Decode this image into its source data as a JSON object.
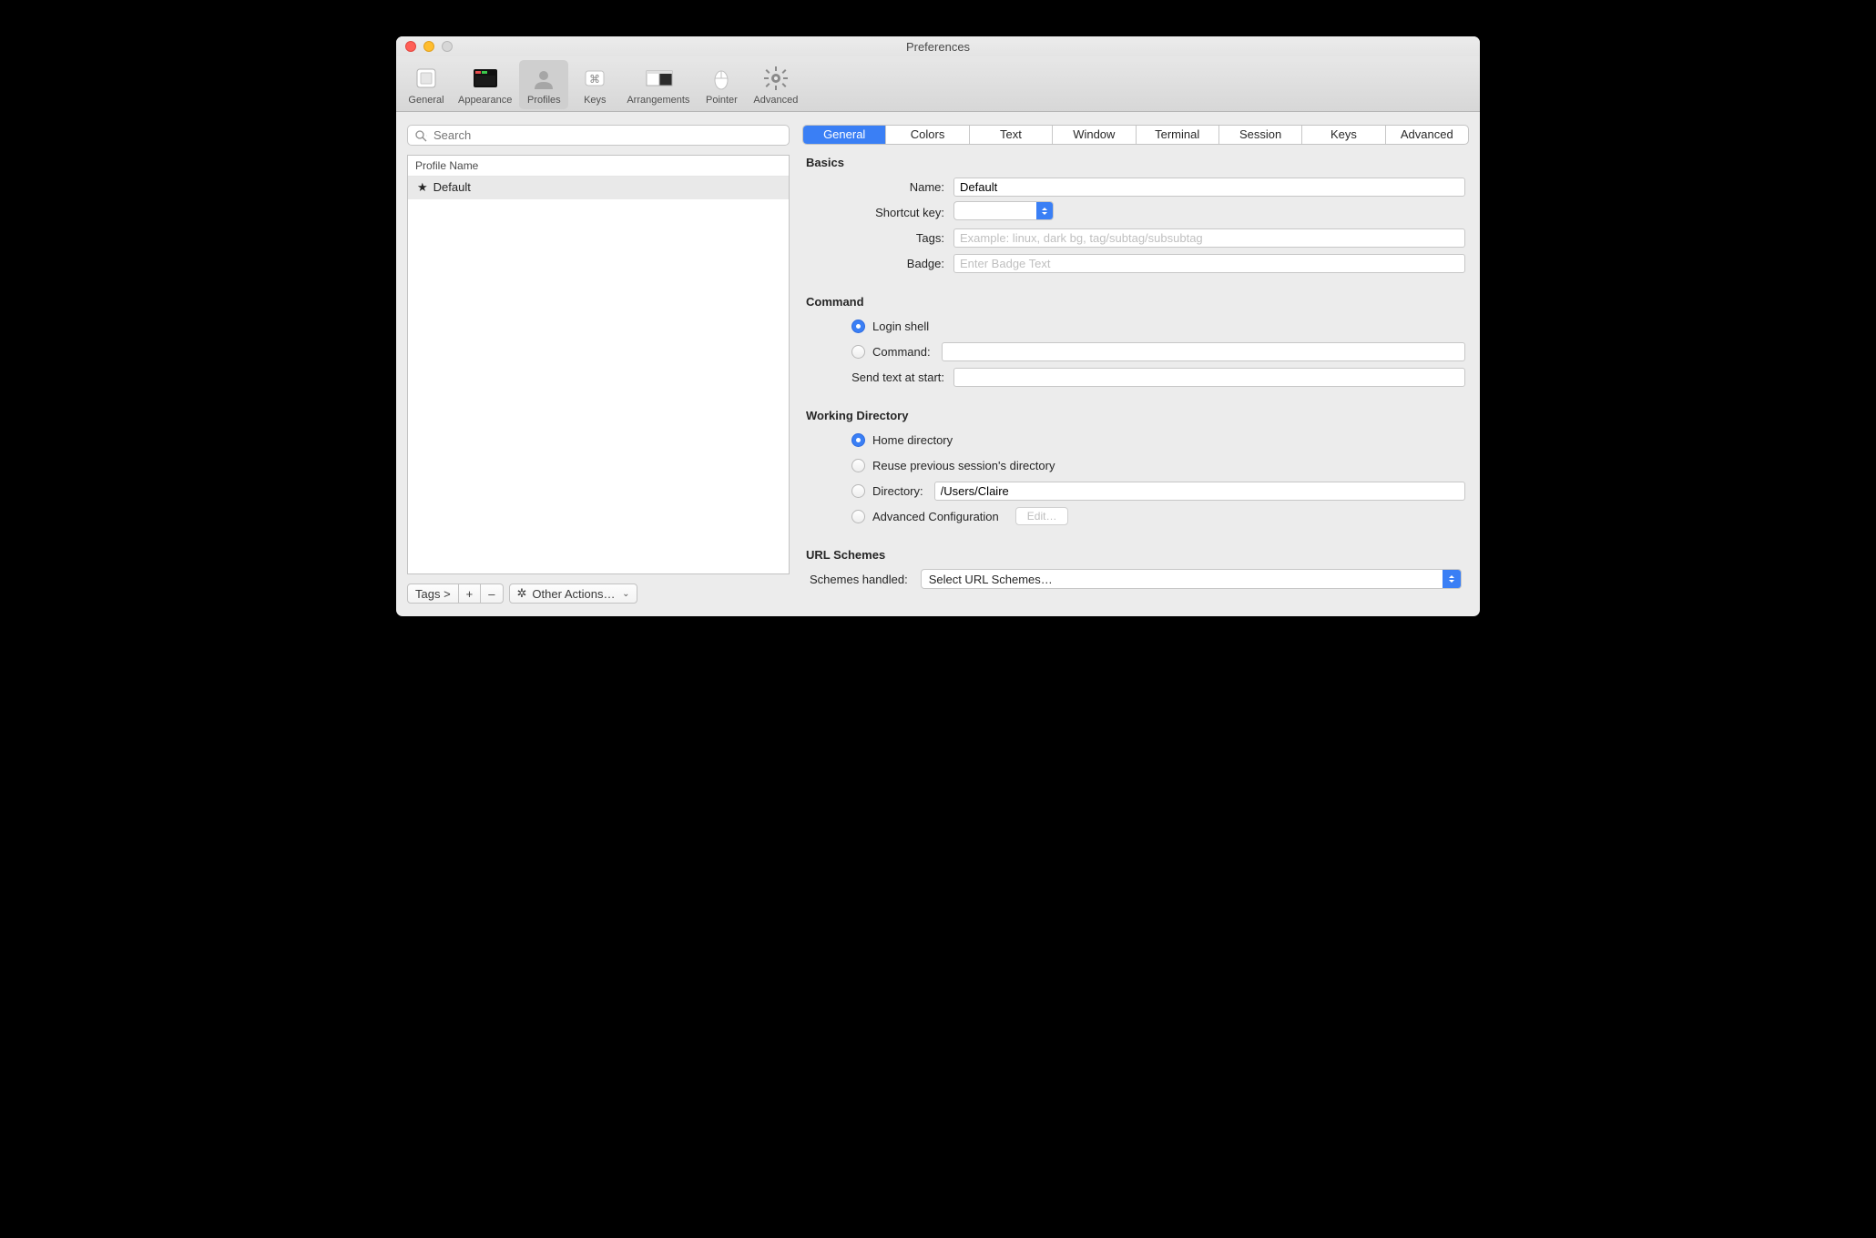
{
  "window": {
    "title": "Preferences"
  },
  "toolbar": {
    "items": [
      {
        "label": "General"
      },
      {
        "label": "Appearance"
      },
      {
        "label": "Profiles"
      },
      {
        "label": "Keys"
      },
      {
        "label": "Arrangements"
      },
      {
        "label": "Pointer"
      },
      {
        "label": "Advanced"
      }
    ],
    "selected": "Profiles"
  },
  "sidebar": {
    "search_placeholder": "Search",
    "header": "Profile Name",
    "rows": [
      {
        "star": "★",
        "name": "Default"
      }
    ],
    "bottom": {
      "tags_label": "Tags >",
      "plus": "+",
      "minus": "–",
      "other_label": "Other Actions…"
    }
  },
  "tabs": [
    "General",
    "Colors",
    "Text",
    "Window",
    "Terminal",
    "Session",
    "Keys",
    "Advanced"
  ],
  "active_tab": "General",
  "basics": {
    "heading": "Basics",
    "name_label": "Name:",
    "name_value": "Default",
    "shortcut_label": "Shortcut key:",
    "tags_label": "Tags:",
    "tags_placeholder": "Example: linux, dark bg, tag/subtag/subsubtag",
    "badge_label": "Badge:",
    "badge_placeholder": "Enter Badge Text"
  },
  "command": {
    "heading": "Command",
    "login_shell_label": "Login shell",
    "command_label": "Command:",
    "send_text_label": "Send text at start:"
  },
  "working_dir": {
    "heading": "Working Directory",
    "home_label": "Home directory",
    "reuse_label": "Reuse previous session's directory",
    "directory_label": "Directory:",
    "directory_value": "/Users/Claire",
    "adv_label": "Advanced Configuration",
    "edit_button": "Edit…"
  },
  "url_schemes": {
    "heading": "URL Schemes",
    "handled_label": "Schemes handled:",
    "select_label": "Select URL Schemes…"
  }
}
